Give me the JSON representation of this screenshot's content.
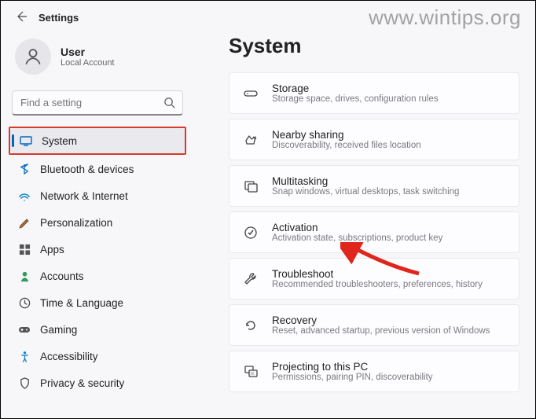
{
  "watermark": "www.wintips.org",
  "topbar": {
    "title": "Settings"
  },
  "profile": {
    "name": "User",
    "sub": "Local Account"
  },
  "search": {
    "placeholder": "Find a setting"
  },
  "nav": [
    {
      "id": "system",
      "label": "System",
      "selected": true,
      "highlight": true
    },
    {
      "id": "bluetooth",
      "label": "Bluetooth & devices"
    },
    {
      "id": "network",
      "label": "Network & Internet"
    },
    {
      "id": "personalization",
      "label": "Personalization"
    },
    {
      "id": "apps",
      "label": "Apps"
    },
    {
      "id": "accounts",
      "label": "Accounts"
    },
    {
      "id": "time",
      "label": "Time & Language"
    },
    {
      "id": "gaming",
      "label": "Gaming"
    },
    {
      "id": "accessibility",
      "label": "Accessibility"
    },
    {
      "id": "privacy",
      "label": "Privacy & security"
    }
  ],
  "page": {
    "title": "System"
  },
  "cards": [
    {
      "id": "storage",
      "icon": "storage-icon",
      "title": "Storage",
      "sub": "Storage space, drives, configuration rules"
    },
    {
      "id": "nearby",
      "icon": "nearby-icon",
      "title": "Nearby sharing",
      "sub": "Discoverability, received files location"
    },
    {
      "id": "multitasking",
      "icon": "multitasking-icon",
      "title": "Multitasking",
      "sub": "Snap windows, virtual desktops, task switching"
    },
    {
      "id": "activation",
      "icon": "activation-icon",
      "title": "Activation",
      "sub": "Activation state, subscriptions, product key"
    },
    {
      "id": "troubleshoot",
      "icon": "troubleshoot-icon",
      "title": "Troubleshoot",
      "sub": "Recommended troubleshooters, preferences, history"
    },
    {
      "id": "recovery",
      "icon": "recovery-icon",
      "title": "Recovery",
      "sub": "Reset, advanced startup, previous version of Windows"
    },
    {
      "id": "projecting",
      "icon": "projecting-icon",
      "title": "Projecting to this PC",
      "sub": "Permissions, pairing PIN, discoverability"
    }
  ]
}
